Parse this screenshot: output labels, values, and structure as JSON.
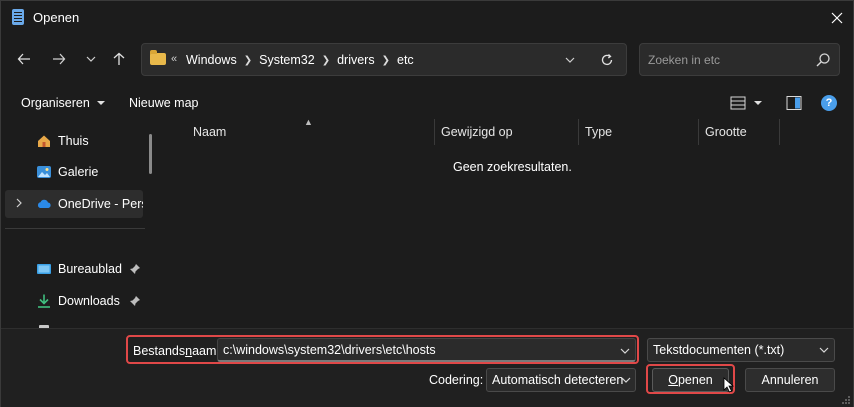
{
  "window": {
    "title": "Openen"
  },
  "address": {
    "crumbs": [
      "Windows",
      "System32",
      "drivers",
      "etc"
    ]
  },
  "search": {
    "placeholder": "Zoeken in etc"
  },
  "toolbar": {
    "organize_label": "Organiseren",
    "new_folder_label": "Nieuwe map"
  },
  "sidebar": {
    "items": [
      {
        "label": "Thuis",
        "icon": "home-icon"
      },
      {
        "label": "Galerie",
        "icon": "gallery-icon"
      },
      {
        "label": "OneDrive - Persoonlijk",
        "icon": "onedrive-icon"
      },
      {
        "label": "Bureaublad",
        "icon": "desktop-icon"
      },
      {
        "label": "Downloads",
        "icon": "download-icon"
      }
    ]
  },
  "columns": [
    "Naam",
    "Gewijzigd op",
    "Type",
    "Grootte"
  ],
  "file_list": {
    "empty_message": "Geen zoekresultaten."
  },
  "footer": {
    "filename_label_pre": "Bestands",
    "filename_label_ul": "n",
    "filename_label_post": "aam:",
    "filename_value": "c:\\windows\\system32\\drivers\\etc\\hosts",
    "filetype_value": "Tekstdocumenten (*.txt)",
    "encoding_label": "Codering:",
    "encoding_value": "Automatisch detecteren",
    "open_label_ul": "O",
    "open_label_rest": "penen",
    "cancel_label": "Annuleren"
  },
  "colors": {
    "accent": "#4a9eea",
    "highlight": "#e04848",
    "folder": "#e8b84a"
  }
}
